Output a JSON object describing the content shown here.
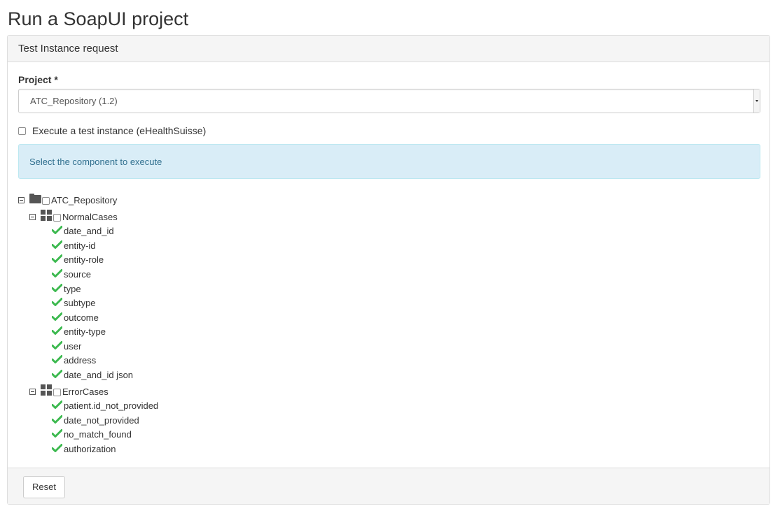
{
  "page": {
    "title": "Run a SoapUI project"
  },
  "panel": {
    "heading": "Test Instance request"
  },
  "form": {
    "project_label": "Project *",
    "project_value": "ATC_Repository (1.2)",
    "execute_label": "Execute a test instance (eHealthSuisse)",
    "info_message": "Select the component to execute"
  },
  "tree": {
    "root": "ATC_Repository",
    "suites": [
      {
        "name": "NormalCases",
        "cases": [
          "date_and_id",
          "entity-id",
          "entity-role",
          "source",
          "type",
          "subtype",
          "outcome",
          "entity-type",
          "user",
          "address",
          "date_and_id json"
        ]
      },
      {
        "name": "ErrorCases",
        "cases": [
          "patient.id_not_provided",
          "date_not_provided",
          "no_match_found",
          "authorization"
        ]
      }
    ]
  },
  "footer": {
    "reset_label": "Reset"
  },
  "colors": {
    "check": "#3cb94f",
    "info_bg": "#d9edf7",
    "info_text": "#31708f"
  }
}
